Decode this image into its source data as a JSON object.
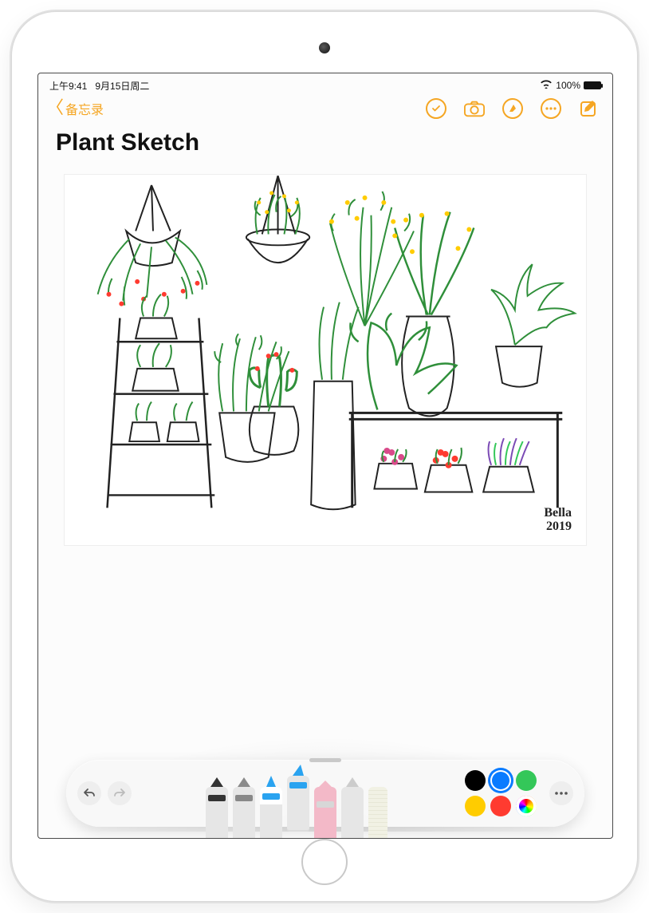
{
  "status": {
    "time": "上午9:41",
    "date": "9月15日周二",
    "battery": "100%"
  },
  "nav": {
    "back_label": "备忘录"
  },
  "note": {
    "title": "Plant Sketch",
    "signature_name": "Bella",
    "signature_year": "2019"
  },
  "markup": {
    "tools": [
      {
        "id": "pen",
        "name": "pen-tool"
      },
      {
        "id": "pencil",
        "name": "pencil-tool"
      },
      {
        "id": "marker",
        "name": "marker-tool"
      },
      {
        "id": "highlighter",
        "name": "highlighter-tool"
      },
      {
        "id": "eraser",
        "name": "eraser-tool"
      },
      {
        "id": "lasso",
        "name": "lasso-tool"
      },
      {
        "id": "ruler",
        "name": "ruler-tool"
      }
    ],
    "selected_tool": "highlighter",
    "colors": {
      "black": "#000000",
      "blue": "#0a7bff",
      "green": "#34c759",
      "yellow": "#ffcc00",
      "red": "#ff3b30"
    },
    "selected_color": "blue"
  }
}
